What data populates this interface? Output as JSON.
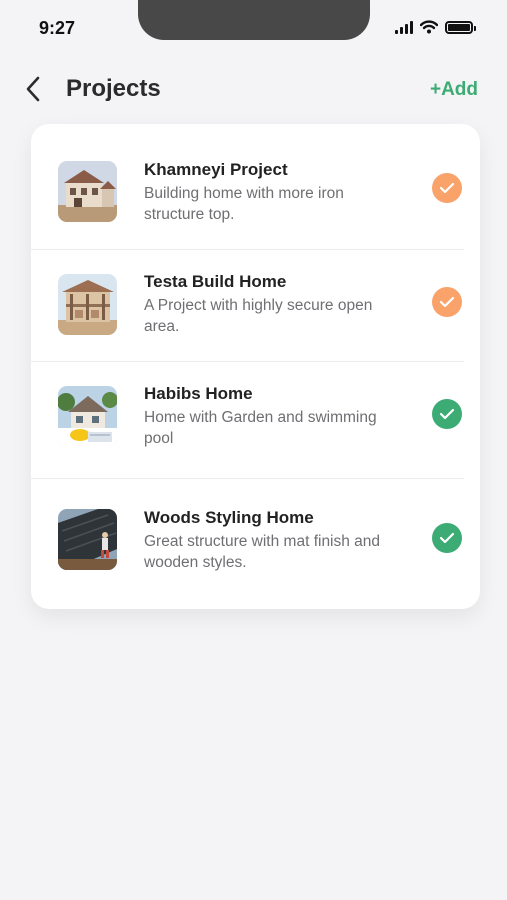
{
  "status_bar": {
    "time": "9:27"
  },
  "header": {
    "title": "Projects",
    "add_label": "+Add"
  },
  "colors": {
    "accent_green": "#3dab74",
    "check_orange": "#f9a36b",
    "check_green": "#3dab74"
  },
  "projects": [
    {
      "name": "Khamneyi Project",
      "description": "Building home with more iron structure top.",
      "status_color": "#f9a36b",
      "image": "house-under-construction"
    },
    {
      "name": "Testa Build Home",
      "description": "A Project with highly secure open area.",
      "status_color": "#f9a36b",
      "image": "building-frame"
    },
    {
      "name": "Habibs Home",
      "description": "Home with Garden and swimming pool",
      "status_color": "#3dab74",
      "image": "house-with-garden"
    },
    {
      "name": "Woods Styling Home",
      "description": "Great structure with mat finish and wooden styles.",
      "status_color": "#3dab74",
      "image": "roof-worker"
    }
  ]
}
